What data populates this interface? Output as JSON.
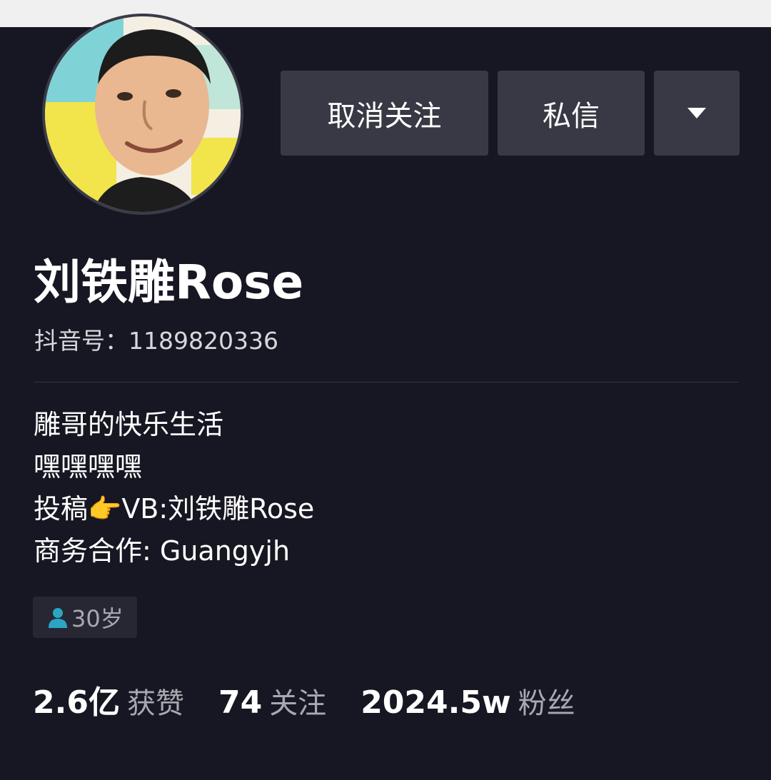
{
  "header": {
    "unfollow_label": "取消关注",
    "message_label": "私信"
  },
  "profile": {
    "name": "刘铁雕Rose",
    "douyin_id": "抖音号：1189820336",
    "bio": [
      "雕哥的快乐生活",
      "嘿嘿嘿嘿",
      "投稿👉VB:刘铁雕Rose",
      "商务合作: Guangyjh"
    ],
    "age_tag": "30岁"
  },
  "stats": [
    {
      "value": "2.6亿",
      "label": "获赞"
    },
    {
      "value": "74",
      "label": "关注"
    },
    {
      "value": "2024.5w",
      "label": "粉丝"
    }
  ],
  "icons": {
    "more": "dropdown-triangle-icon",
    "age": "person-icon"
  },
  "colors": {
    "background": "#161722",
    "button": "#383944",
    "tag_icon": "#2aa6c4"
  }
}
